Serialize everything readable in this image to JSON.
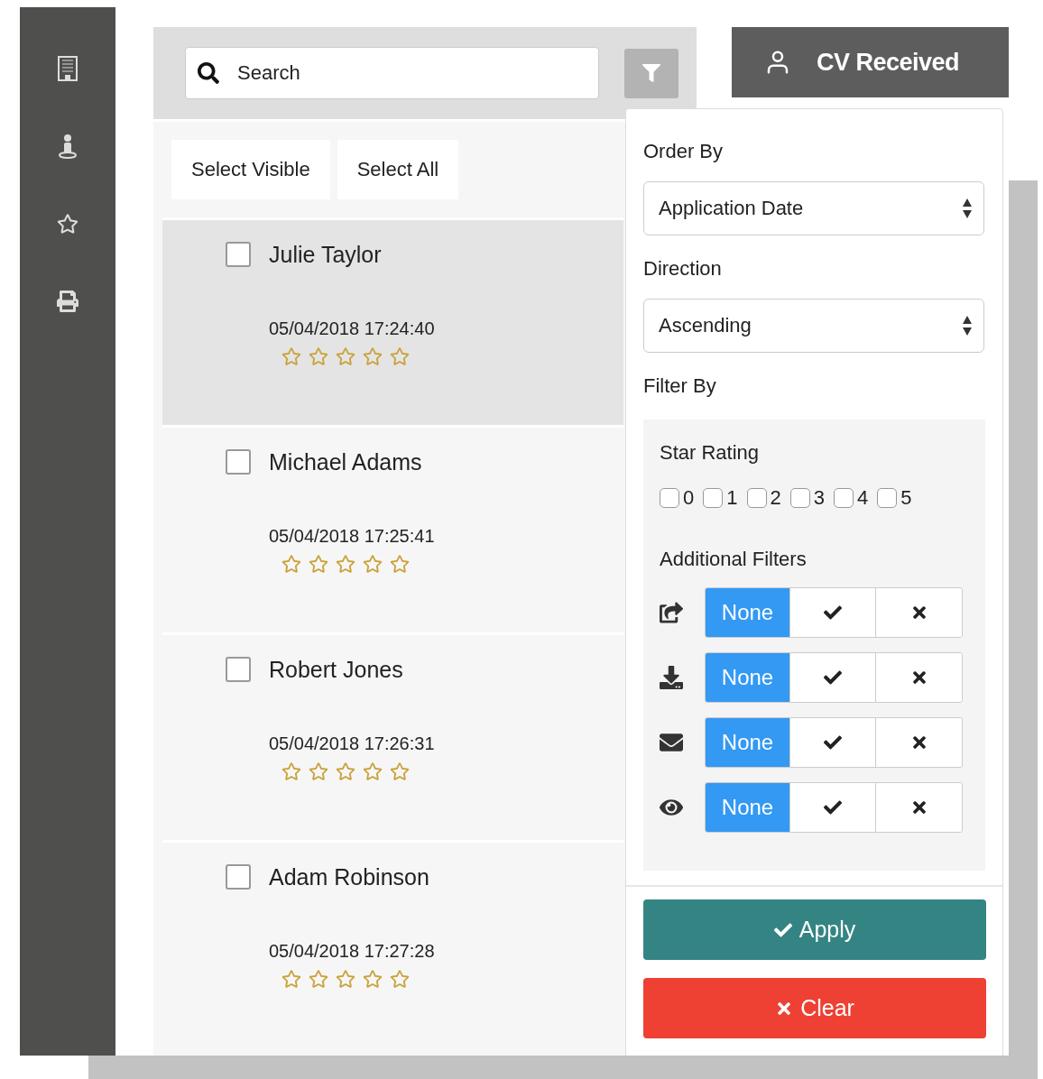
{
  "search": {
    "placeholder": "Search"
  },
  "list_actions": [
    "Select Visible",
    "Select All"
  ],
  "candidates": [
    {
      "name": "Julie Taylor",
      "date": "05/04/2018 17:24:40",
      "stars": 0,
      "checked": false,
      "selected": true
    },
    {
      "name": "Michael Adams",
      "date": "05/04/2018 17:25:41",
      "stars": 0,
      "checked": false,
      "selected": false
    },
    {
      "name": "Robert Jones",
      "date": "05/04/2018 17:26:31",
      "stars": 0,
      "checked": false,
      "selected": false
    },
    {
      "name": "Adam Robinson",
      "date": "05/04/2018 17:27:28",
      "stars": 0,
      "checked": false,
      "selected": false
    }
  ],
  "stage_header": {
    "title": "CV Received"
  },
  "filter_panel": {
    "order_by_label": "Order By",
    "order_by": "Application Date",
    "direction_label": "Direction",
    "direction": "Ascending",
    "filter_by_label": "Filter By",
    "star_rating": {
      "title": "Star Rating",
      "options": [
        {
          "label": "0",
          "checked": false
        },
        {
          "label": "1",
          "checked": false
        },
        {
          "label": "2",
          "checked": false
        },
        {
          "label": "3",
          "checked": false
        },
        {
          "label": "4",
          "checked": false
        },
        {
          "label": "5",
          "checked": false
        }
      ]
    },
    "additional_filters": {
      "title": "Additional Filters",
      "rows": [
        {
          "kind": "forwarded",
          "options": [
            {
              "kind": "none",
              "label": "None",
              "selected": true
            },
            {
              "kind": "yes",
              "selected": false
            },
            {
              "kind": "no",
              "selected": false
            }
          ]
        },
        {
          "kind": "downloaded",
          "options": [
            {
              "kind": "none",
              "label": "None",
              "selected": true
            },
            {
              "kind": "yes",
              "selected": false
            },
            {
              "kind": "no",
              "selected": false
            }
          ]
        },
        {
          "kind": "emailed",
          "options": [
            {
              "kind": "none",
              "label": "None",
              "selected": true
            },
            {
              "kind": "yes",
              "selected": false
            },
            {
              "kind": "no",
              "selected": false
            }
          ]
        },
        {
          "kind": "viewed",
          "options": [
            {
              "kind": "none",
              "label": "None",
              "selected": true
            },
            {
              "kind": "yes",
              "selected": false
            },
            {
              "kind": "no",
              "selected": false
            }
          ]
        }
      ]
    },
    "apply": "Apply",
    "clear": "Clear"
  }
}
